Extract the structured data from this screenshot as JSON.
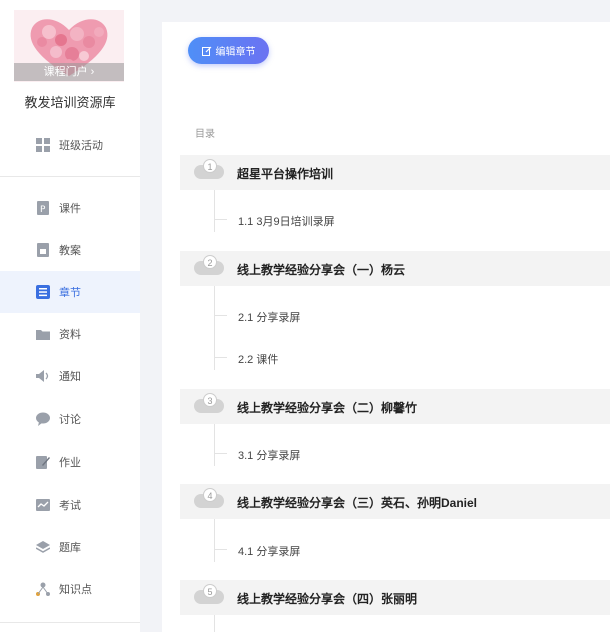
{
  "course": {
    "portal_label": "课程门户 ›",
    "title": "教发培训资源库"
  },
  "sidebar": {
    "items": [
      {
        "label": "班级活动",
        "icon": "grid-icon"
      },
      {
        "label": "课件",
        "icon": "ppt-file-icon"
      },
      {
        "label": "教案",
        "icon": "lesson-plan-icon"
      },
      {
        "label": "章节",
        "icon": "list-icon",
        "active": true
      },
      {
        "label": "资料",
        "icon": "folder-icon"
      },
      {
        "label": "通知",
        "icon": "speaker-icon"
      },
      {
        "label": "讨论",
        "icon": "chat-bubble-icon"
      },
      {
        "label": "作业",
        "icon": "edit-document-icon"
      },
      {
        "label": "考试",
        "icon": "exam-icon"
      },
      {
        "label": "题库",
        "icon": "layers-icon"
      },
      {
        "label": "知识点",
        "icon": "knowledge-graph-icon"
      }
    ]
  },
  "toolbar": {
    "edit_label": "编辑章节"
  },
  "toc": {
    "label": "目录",
    "chapters": [
      {
        "num": "1",
        "title": "超星平台操作培训",
        "subs": [
          "1.1 3月9日培训录屏"
        ]
      },
      {
        "num": "2",
        "title": "线上教学经验分享会（一）杨云",
        "subs": [
          "2.1 分享录屏",
          "2.2 课件"
        ]
      },
      {
        "num": "3",
        "title": "线上教学经验分享会（二）柳馨竹",
        "subs": [
          "3.1 分享录屏"
        ]
      },
      {
        "num": "4",
        "title": "线上教学经验分享会（三）英石、孙明Daniel",
        "subs": [
          "4.1 分享录屏"
        ]
      },
      {
        "num": "5",
        "title": "线上教学经验分享会（四）张丽明",
        "subs": []
      }
    ]
  },
  "colors": {
    "accent": "#3a6fe0",
    "button_start": "#4f8ff7",
    "button_end": "#6b72f2",
    "active_bg": "#eef3fd"
  }
}
